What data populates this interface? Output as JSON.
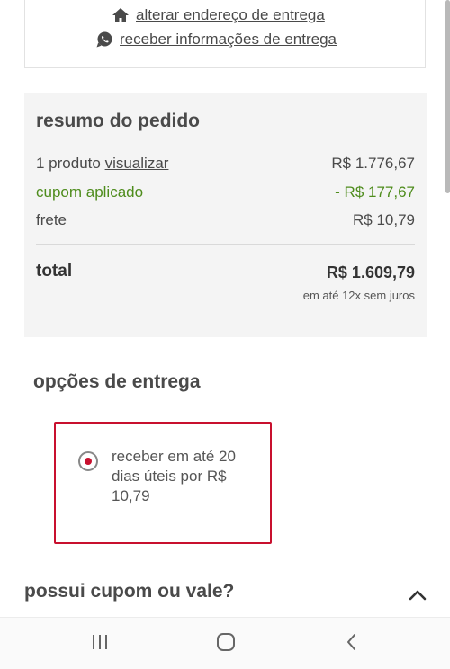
{
  "address": {
    "change_address_label": "alterar endereço de entrega",
    "delivery_info_label": "receber informações de entrega"
  },
  "summary": {
    "title": "resumo do pedido",
    "products_label": "1 produto",
    "view_label": "visualizar",
    "products_value": "R$ 1.776,67",
    "coupon_label": "cupom aplicado",
    "coupon_value": "- R$ 177,67",
    "shipping_label": "frete",
    "shipping_value": "R$ 10,79",
    "total_label": "total",
    "total_value": "R$ 1.609,79",
    "installments": "em até 12x sem juros"
  },
  "delivery": {
    "title": "opções de entrega",
    "option_text": "receber em até 20 dias úteis por R$ 10,79",
    "selected": true
  },
  "coupon": {
    "title": "possui cupom ou vale?"
  },
  "icons": {
    "home": "home-icon",
    "whatsapp": "whatsapp-icon",
    "chevron": "chevron-up-icon",
    "recents": "recents-icon",
    "home_nav": "home-nav-icon",
    "back": "back-icon"
  },
  "colors": {
    "accent": "#c8102e",
    "discount_green": "#4e8c1c",
    "summary_bg": "#f4f4f4"
  }
}
